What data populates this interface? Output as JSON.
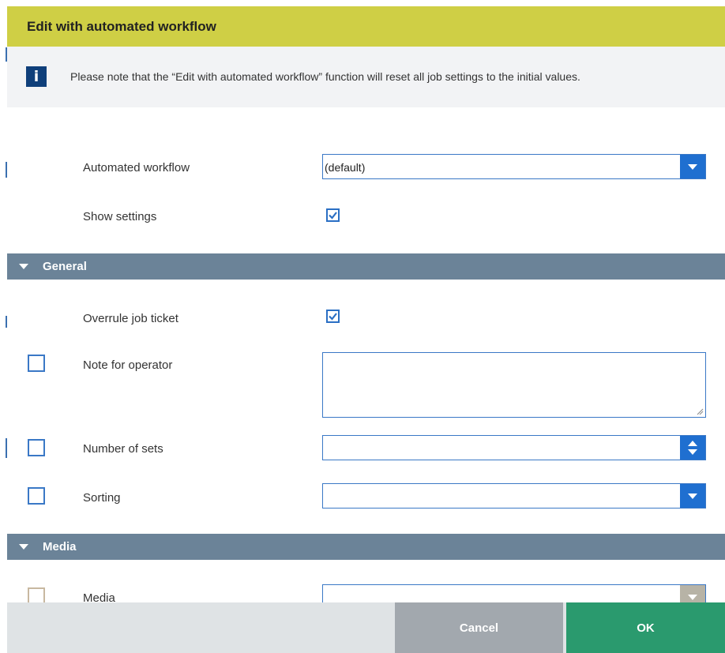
{
  "dialog": {
    "title": "Edit with automated workflow",
    "info_text": "Please note that the “Edit with automated workflow” function will reset all job settings to the initial values.",
    "info_icon": "info-icon"
  },
  "top": {
    "automated_workflow_label": "Automated workflow",
    "automated_workflow_value": "(default)",
    "show_settings_label": "Show settings",
    "show_settings_checked": true
  },
  "sections": {
    "general": {
      "title": "General",
      "overrule_label": "Overrule job ticket",
      "overrule_checked": true,
      "note_label": "Note for operator",
      "note_value": "",
      "sets_label": "Number of sets",
      "sets_value": "",
      "sorting_label": "Sorting",
      "sorting_value": ""
    },
    "media": {
      "title": "Media",
      "media_label": "Media",
      "media_value": ""
    }
  },
  "footer": {
    "cancel_label": "Cancel",
    "ok_label": "OK"
  },
  "colors": {
    "title_bar": "#cfcf45",
    "section_header": "#6b8398",
    "accent_blue": "#1f6fd0",
    "ok_green": "#2a9a6e",
    "cancel_gray": "#a2a8ae"
  }
}
